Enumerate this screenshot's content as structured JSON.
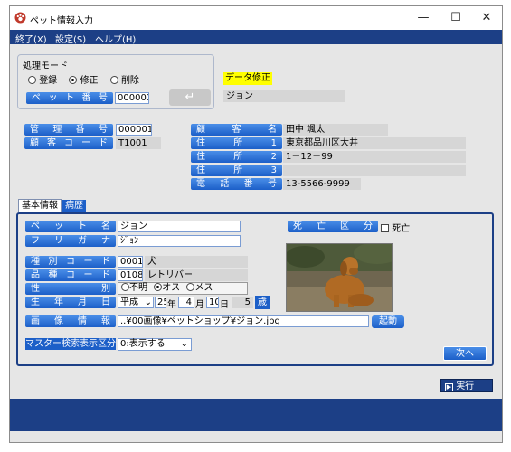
{
  "window": {
    "title": "ペット情報入力",
    "controls": {
      "minimize": "—",
      "maximize": "☐",
      "close": "✕"
    }
  },
  "menu": {
    "items": [
      "終了(X)",
      "設定(S)",
      "ヘルプ(H)"
    ]
  },
  "mode_group": {
    "title": "処理モード",
    "options": [
      "登録",
      "修正",
      "削除"
    ],
    "selected": "修正"
  },
  "pet_number": {
    "label": "ペット番号",
    "value": "000001",
    "enter_glyph": "↵"
  },
  "status": {
    "mode_badge": "データ修正",
    "pet_name_display": "ジョン"
  },
  "customer": {
    "mgmt_no_label": "管理番号",
    "mgmt_no": "000001",
    "code_label": "顧客コード",
    "code": "T1001",
    "name_label": "顧客名",
    "name": "田中 颯太",
    "addr1_label": "住所1",
    "addr1": "東京都品川区大井",
    "addr2_label": "住所2",
    "addr2": "1－12－99",
    "addr3_label": "住所3",
    "addr3": "",
    "phone_label": "電話番号",
    "phone": "13-5566-9999"
  },
  "tabs": {
    "basic": "基本情報",
    "history": "病歴"
  },
  "pet": {
    "name_label": "ペット名",
    "name": "ジョン",
    "kana_label": "フリガナ",
    "kana": "ｼﾞｮﾝ",
    "type_label": "種別コード",
    "type_code": "0001",
    "type_name": "犬",
    "breed_label": "品種コード",
    "breed_code": "0108",
    "breed_name": "レトリバー",
    "sex_label": "性別",
    "sex_options": [
      "不明",
      "オス",
      "メス"
    ],
    "sex_selected": "オス",
    "birth_label": "生年月日",
    "era": "平成",
    "year": "25",
    "year_unit": "年",
    "month": "4",
    "month_unit": "月",
    "day": "10",
    "day_unit": "日",
    "age": "5",
    "age_unit": "歳",
    "deceased_label": "死亡区分",
    "deceased_check_label": "死亡",
    "deceased": false,
    "image_label": "画像情報",
    "image_path": "..¥00画像¥ペットショップ¥ジョン.jpg",
    "launch_button": "起動",
    "master_label": "マスター検索表示区分",
    "master_value": "0:表示する"
  },
  "buttons": {
    "next": "次へ",
    "execute": "実行"
  },
  "colors": {
    "menubar": "#1c3f86",
    "label_blue": "#1c5fc8",
    "badge_yellow": "#ffff00"
  }
}
